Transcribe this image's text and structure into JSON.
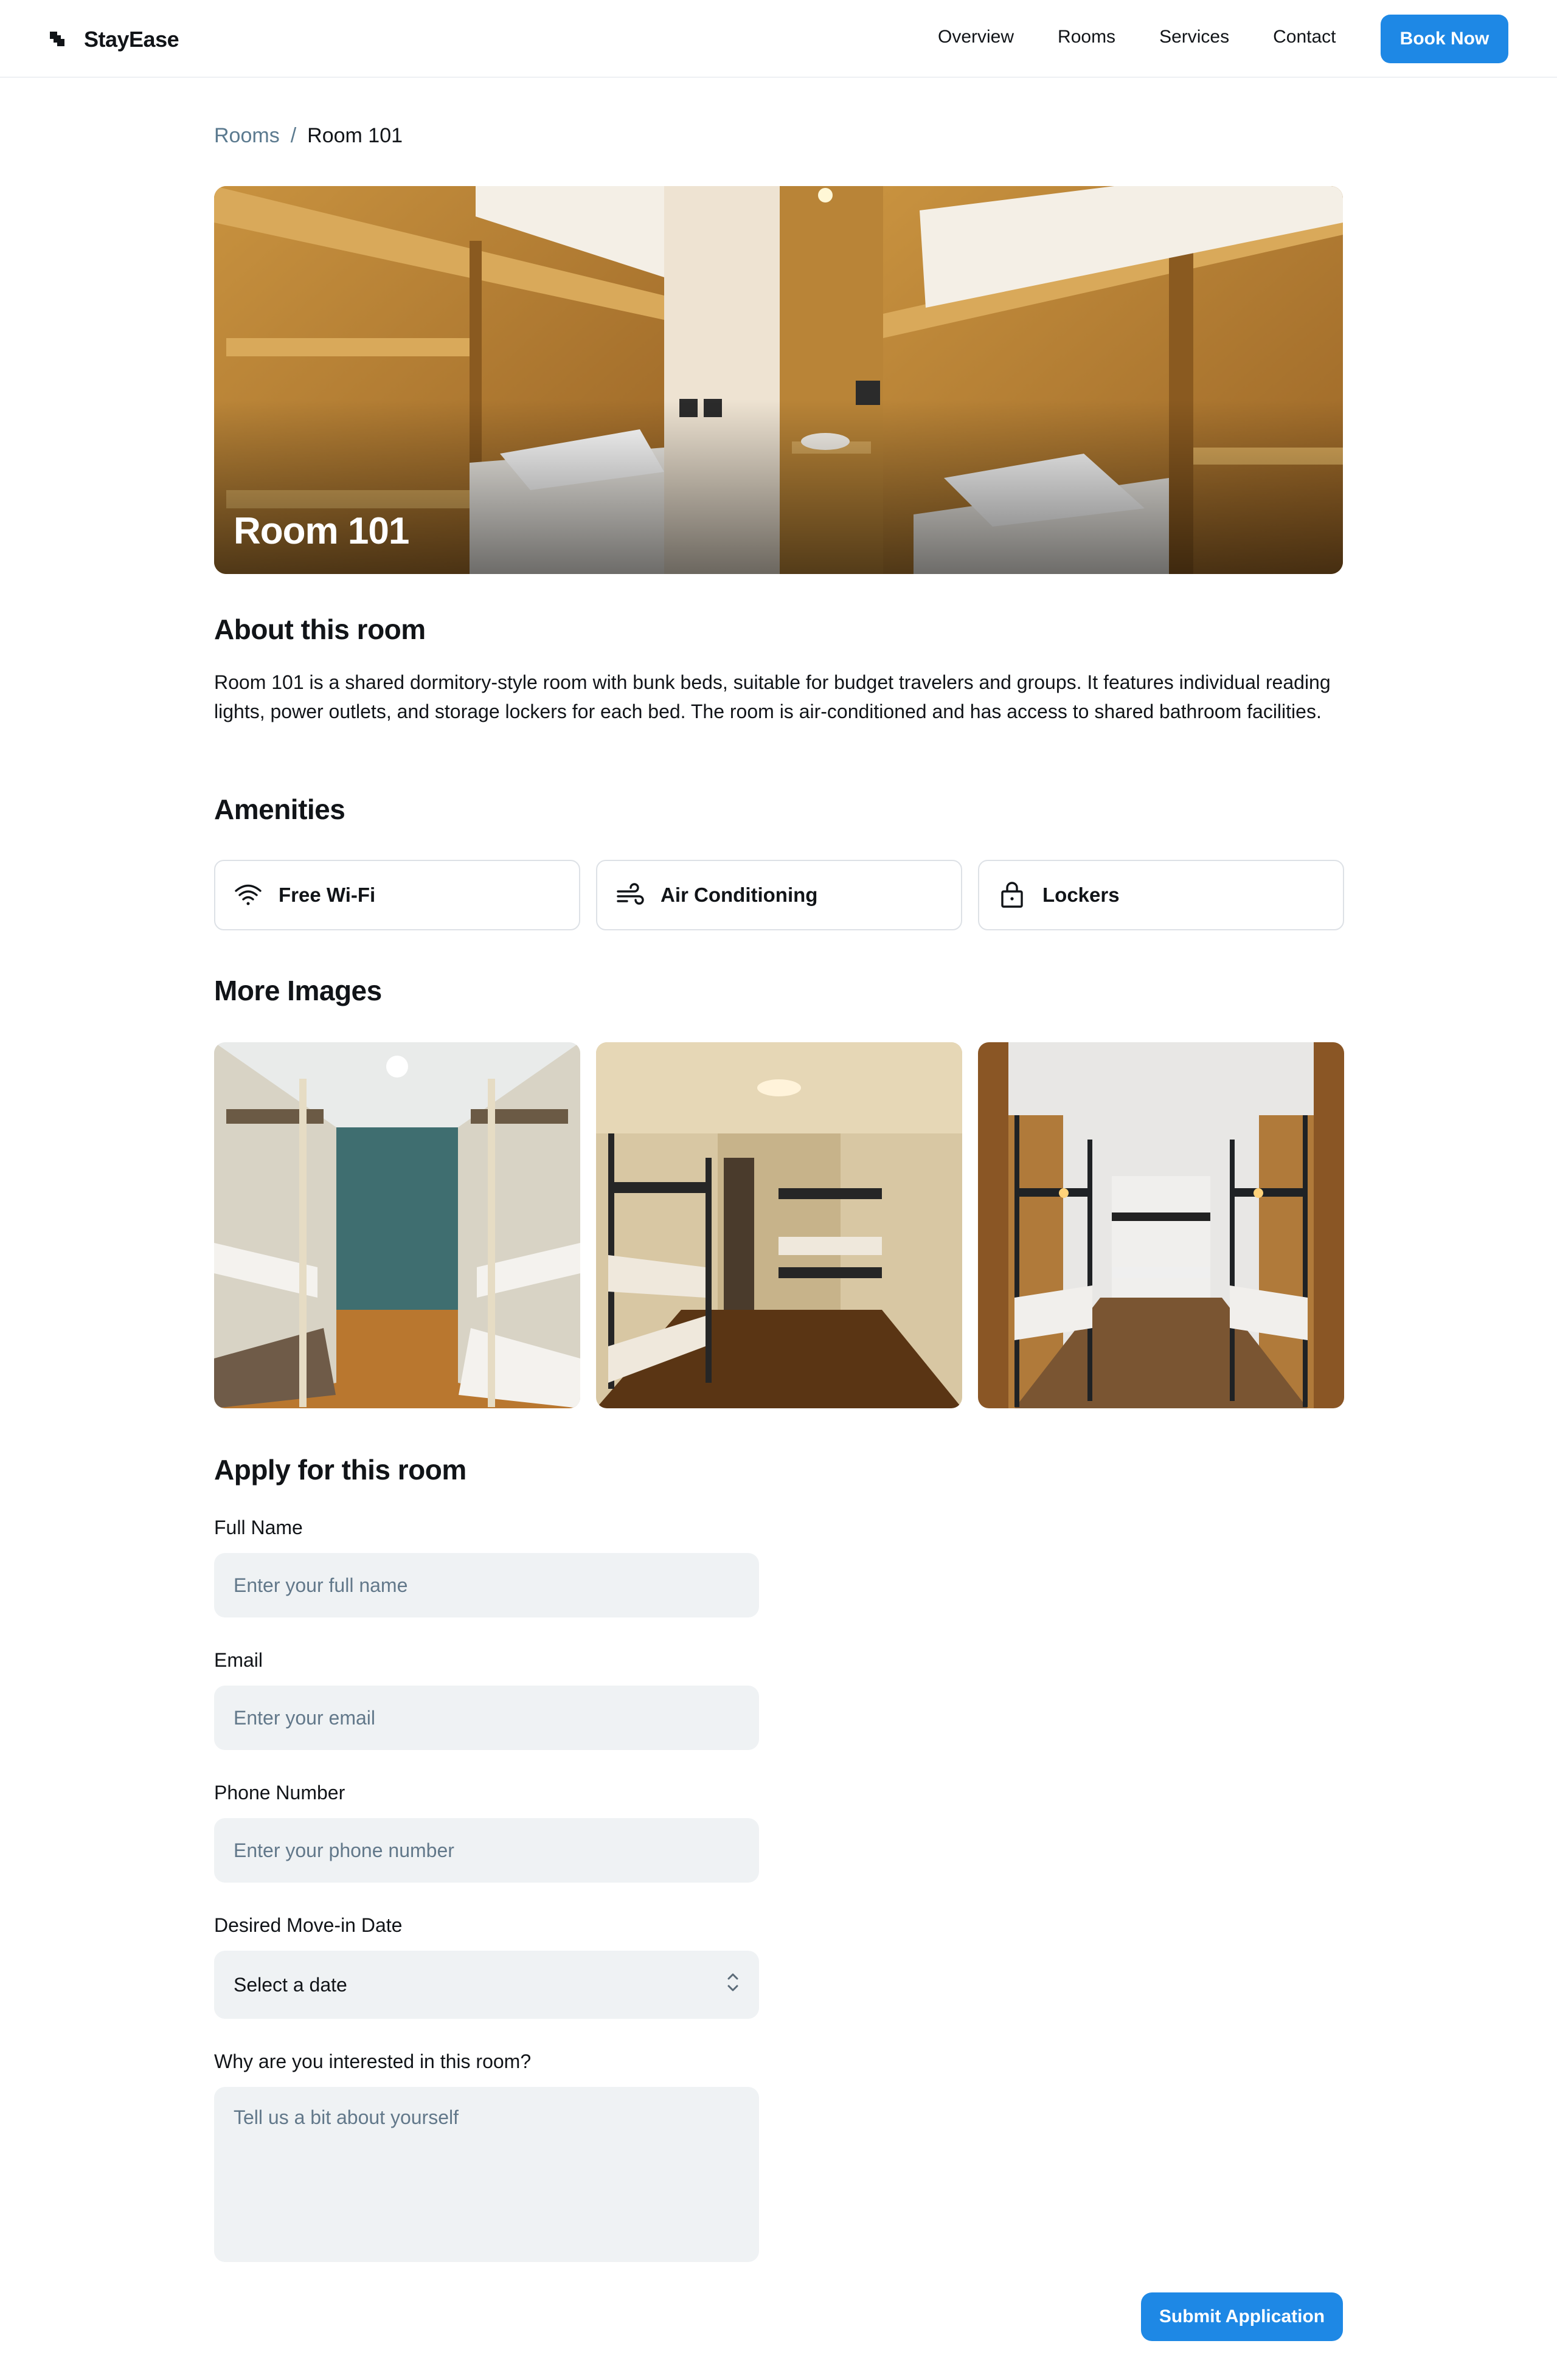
{
  "header": {
    "brand": "StayEase",
    "nav": [
      "Overview",
      "Rooms",
      "Services",
      "Contact"
    ],
    "book_button": "Book Now"
  },
  "breadcrumb": {
    "parent": "Rooms",
    "separator": "/",
    "current": "Room 101"
  },
  "hero": {
    "title": "Room 101"
  },
  "about": {
    "heading": "About this room",
    "text": "Room 101 is a shared dormitory-style room with bunk beds, suitable for budget travelers and groups. It features individual reading lights, power outlets, and storage lockers for each bed. The room is air-conditioned and has access to shared bathroom facilities."
  },
  "amenities": {
    "heading": "Amenities",
    "items": [
      {
        "label": "Free Wi-Fi",
        "icon": "wifi-icon"
      },
      {
        "label": "Air Conditioning",
        "icon": "wind-icon"
      },
      {
        "label": "Lockers",
        "icon": "lock-icon"
      }
    ]
  },
  "gallery": {
    "heading": "More Images"
  },
  "form": {
    "heading": "Apply for this room",
    "full_name_label": "Full Name",
    "full_name_placeholder": "Enter your full name",
    "email_label": "Email",
    "email_placeholder": "Enter your email",
    "phone_label": "Phone Number",
    "phone_placeholder": "Enter your phone number",
    "date_label": "Desired Move-in Date",
    "date_value": "Select a date",
    "reason_label": "Why are you interested in this room?",
    "reason_placeholder": "Tell us a bit about yourself",
    "submit": "Submit Application"
  },
  "colors": {
    "accent": "#1e88e5",
    "input_bg": "#eff2f4",
    "breadcrumb_link": "#5b7a8f"
  }
}
